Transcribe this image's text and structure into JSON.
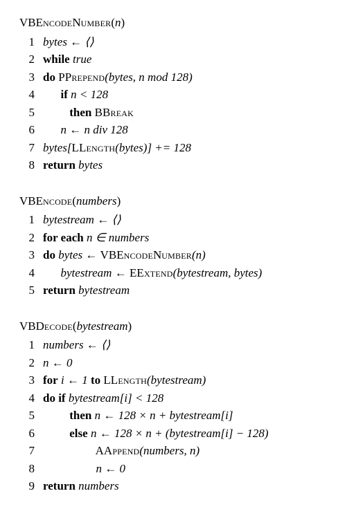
{
  "algo1": {
    "title_prefix": "VBE",
    "title_sc": "ncode",
    "title_prefix2": "N",
    "title_sc2": "umber",
    "arg": "n",
    "lines": {
      "l1_n": "1",
      "l1": "bytes ← ⟨⟩",
      "l2_n": "2",
      "l2_kw": "while",
      "l2_rest": " true",
      "l3_n": "3",
      "l3_kw": "do",
      "l3_sc": "Prepend",
      "l3_rest": "(bytes, n mod 128)",
      "l4_n": "4",
      "l4_kw": "if",
      "l4_rest": " n < 128",
      "l5_n": "5",
      "l5_kw": "then",
      "l5_sc": "Break",
      "l6_n": "6",
      "l6": "n ← n div 128",
      "l7_n": "7",
      "l7_a": "bytes[",
      "l7_sc": "Length",
      "l7_b": "(bytes)] += 128",
      "l8_n": "8",
      "l8_kw": "return",
      "l8_rest": " bytes"
    }
  },
  "algo2": {
    "title_prefix": "VBE",
    "title_sc": "ncode",
    "arg": "numbers",
    "lines": {
      "l1_n": "1",
      "l1": "bytestream ← ⟨⟩",
      "l2_n": "2",
      "l2_kw": "for each",
      "l2_rest": " n ∈ numbers",
      "l3_n": "3",
      "l3_kw": "do",
      "l3_a": " bytes ← ",
      "l3_sc1": "VBE",
      "l3_sc2": "ncode",
      "l3_sc3": "N",
      "l3_sc4": "umber",
      "l3_b": "(n)",
      "l4_n": "4",
      "l4_a": "bytestream ← ",
      "l4_sc": "Extend",
      "l4_b": "(bytestream, bytes)",
      "l5_n": "5",
      "l5_kw": "return",
      "l5_rest": " bytestream"
    }
  },
  "algo3": {
    "title_prefix": "VBD",
    "title_sc": "ecode",
    "arg": "bytestream",
    "lines": {
      "l1_n": "1",
      "l1": "numbers ← ⟨⟩",
      "l2_n": "2",
      "l2": "n ← 0",
      "l3_n": "3",
      "l3_kw1": "for",
      "l3_a": " i ← 1 ",
      "l3_kw2": "to",
      "l3_sc": "Length",
      "l3_b": "(bytestream)",
      "l4_n": "4",
      "l4_kw": "do if",
      "l4_rest": " bytestream[i] < 128",
      "l5_n": "5",
      "l5_kw": "then",
      "l5_rest": " n ← 128 × n + bytestream[i]",
      "l6_n": "6",
      "l6_kw": "else",
      "l6_rest": " n ← 128 × n + (bytestream[i] − 128)",
      "l7_n": "7",
      "l7_sc": "Append",
      "l7_rest": "(numbers, n)",
      "l8_n": "8",
      "l8": "n ← 0",
      "l9_n": "9",
      "l9_kw": "return",
      "l9_rest": " numbers"
    }
  }
}
